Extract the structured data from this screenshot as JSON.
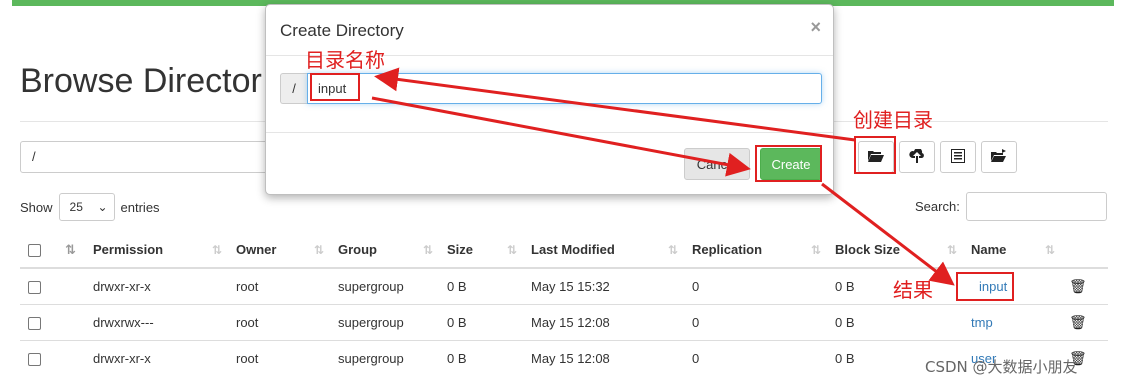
{
  "page": {
    "title": "Browse Director",
    "path": "/"
  },
  "toolbar": {
    "buttons": [
      {
        "name": "create-directory-button",
        "icon": "folder-open-icon"
      },
      {
        "name": "upload-button",
        "icon": "cloud-upload-icon"
      },
      {
        "name": "list-button",
        "icon": "list-icon"
      },
      {
        "name": "cut-paste-button",
        "icon": "folder-move-icon"
      }
    ]
  },
  "entries": {
    "show_label": "Show",
    "value": "25",
    "entries_label": "entries"
  },
  "search": {
    "label": "Search:"
  },
  "table": {
    "headers": [
      "Permission",
      "Owner",
      "Group",
      "Size",
      "Last Modified",
      "Replication",
      "Block Size",
      "Name"
    ],
    "rows": [
      {
        "permission": "drwxr-xr-x",
        "owner": "root",
        "group": "supergroup",
        "size": "0 B",
        "modified": "May 15 15:32",
        "replication": "0",
        "block_size": "0 B",
        "name": "input"
      },
      {
        "permission": "drwxrwx---",
        "owner": "root",
        "group": "supergroup",
        "size": "0 B",
        "modified": "May 15 12:08",
        "replication": "0",
        "block_size": "0 B",
        "name": "tmp"
      },
      {
        "permission": "drwxr-xr-x",
        "owner": "root",
        "group": "supergroup",
        "size": "0 B",
        "modified": "May 15 12:08",
        "replication": "0",
        "block_size": "0 B",
        "name": "user"
      }
    ]
  },
  "modal": {
    "title": "Create Directory",
    "close": "×",
    "prefix": "/",
    "input_value": "input",
    "cancel": "Cancel",
    "create": "Create"
  },
  "annotations": {
    "dir_name": "目录名称",
    "create_dir": "创建目录",
    "result": "结果",
    "color": "#e02020"
  },
  "watermark": "CSDN @大数据小朋友",
  "colors": {
    "accent": "#5cb85c",
    "link": "#337ab7"
  }
}
